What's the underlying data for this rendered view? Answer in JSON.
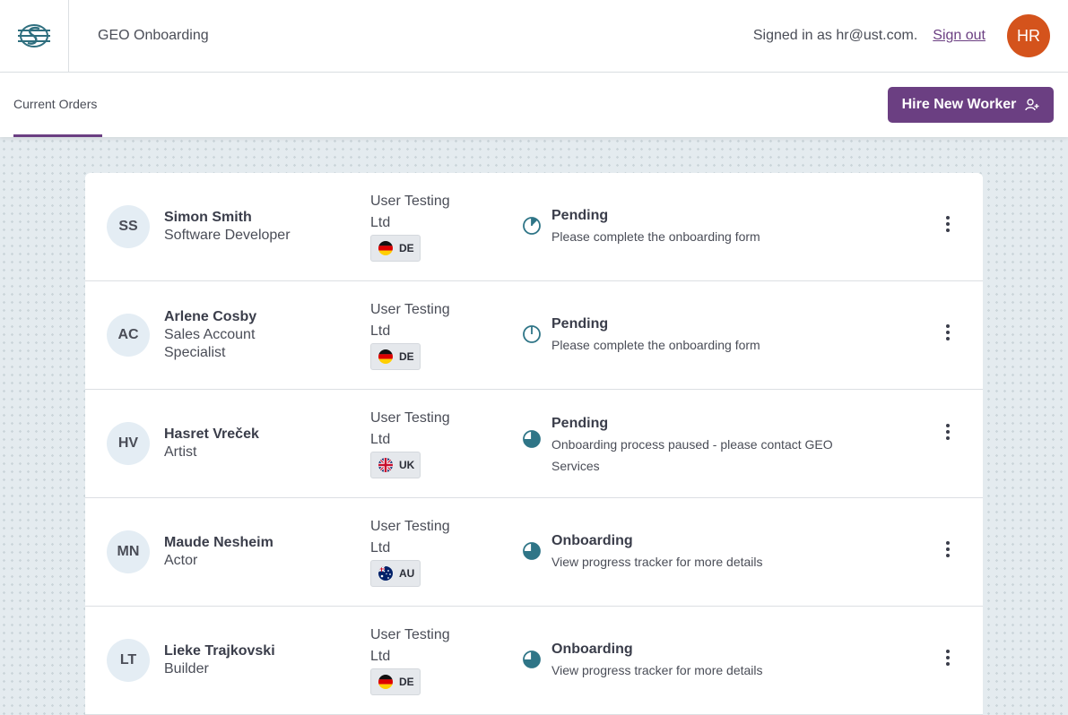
{
  "header": {
    "app_title": "GEO Onboarding",
    "signed_in_text": "Signed in as hr@ust.com.",
    "sign_out_label": "Sign out",
    "avatar_initials": "HR",
    "avatar_color": "#d4531c"
  },
  "toolbar": {
    "tab_current_orders": "Current Orders",
    "hire_button_label": "Hire New Worker",
    "accent_color": "#6b3f82"
  },
  "workers": [
    {
      "initials": "SS",
      "name": "Simon Smith",
      "role_lines": [
        "Software Developer"
      ],
      "company_lines": [
        "User Testing",
        "Ltd"
      ],
      "country": "DE",
      "status": "Pending",
      "status_desc_lines": [
        "Please complete the onboarding form"
      ],
      "progress_fraction": 0.125
    },
    {
      "initials": "AC",
      "name": "Arlene Cosby",
      "role_lines": [
        "Sales Account",
        "Specialist"
      ],
      "company_lines": [
        "User Testing",
        "Ltd"
      ],
      "country": "DE",
      "status": "Pending",
      "status_desc_lines": [
        "Please complete the onboarding form"
      ],
      "progress_fraction": 0
    },
    {
      "initials": "HV",
      "name": "Hasret Vreček",
      "role_lines": [
        "Artist"
      ],
      "company_lines": [
        "User Testing",
        "Ltd"
      ],
      "country": "UK",
      "status": "Pending",
      "status_desc_lines": [
        "Onboarding process paused - please contact GEO",
        "Services"
      ],
      "progress_fraction": 0.75
    },
    {
      "initials": "MN",
      "name": "Maude Nesheim",
      "role_lines": [
        "Actor"
      ],
      "company_lines": [
        "User Testing",
        "Ltd"
      ],
      "country": "AU",
      "status": "Onboarding",
      "status_desc_lines": [
        "View progress tracker for more details"
      ],
      "progress_fraction": 0.75
    },
    {
      "initials": "LT",
      "name": "Lieke Trajkovski",
      "role_lines": [
        "Builder"
      ],
      "company_lines": [
        "User Testing",
        "Ltd"
      ],
      "country": "DE",
      "status": "Onboarding",
      "status_desc_lines": [
        "View progress tracker for more details"
      ],
      "progress_fraction": 0.75
    }
  ],
  "icons": {
    "logo": "geo-logo-icon",
    "hire": "add-user-icon",
    "row_menu": "kebab-menu-icon",
    "status": "progress-pie-icon"
  },
  "colors": {
    "status_teal": "#2f7587",
    "avatar_bg": "#e4edf4"
  }
}
